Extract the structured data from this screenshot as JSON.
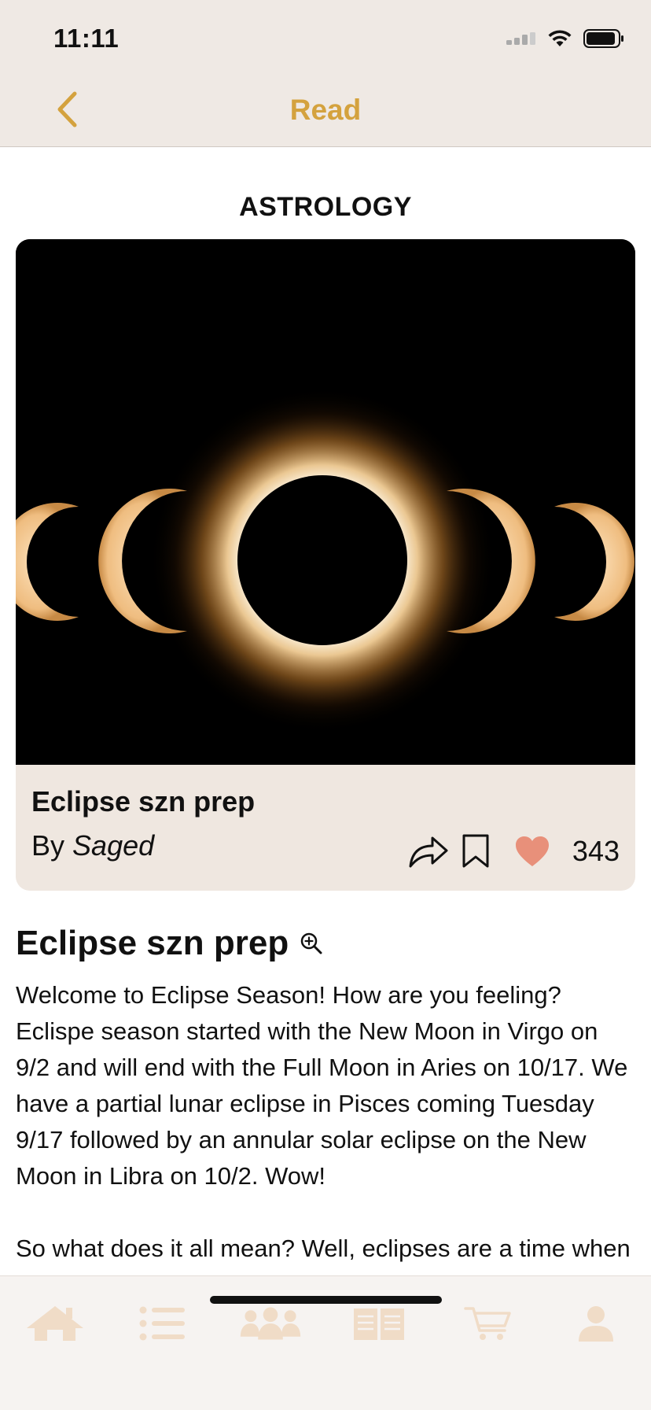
{
  "status_bar": {
    "time": "11:11",
    "icons": [
      "cellular-signal-icon",
      "wifi-icon",
      "battery-icon"
    ]
  },
  "nav": {
    "title": "Read",
    "back_icon": "chevron-left-icon",
    "accent_color": "#d4a23e"
  },
  "article": {
    "category": "ASTROLOGY",
    "card_title": "Eclipse szn prep",
    "author_prefix": "By",
    "author_name": "Saged",
    "like_count": "343",
    "title": "Eclipse szn prep",
    "paragraphs": [
      "Welcome to Eclipse Season! How are you feeling? Eclispe season started with the New Moon in Virgo on 9/2 and will end with the Full Moon in Aries on 10/17. We have a partial lunar eclipse in Pisces coming Tuesday 9/17 followed by an annular solar eclipse on the New Moon in Libra on 10/2. Wow!",
      "So what does it all mean? Well, eclipses are a time when the light from either the Sun or the Moon is"
    ],
    "actions": [
      "share-icon",
      "bookmark-icon",
      "heart-icon"
    ],
    "heart_color": "#e8907a"
  },
  "tab_bar": {
    "items": [
      "home-icon",
      "list-icon",
      "community-icon",
      "read-icon",
      "cart-icon",
      "profile-icon"
    ],
    "icon_color": "#f0dcc7"
  }
}
